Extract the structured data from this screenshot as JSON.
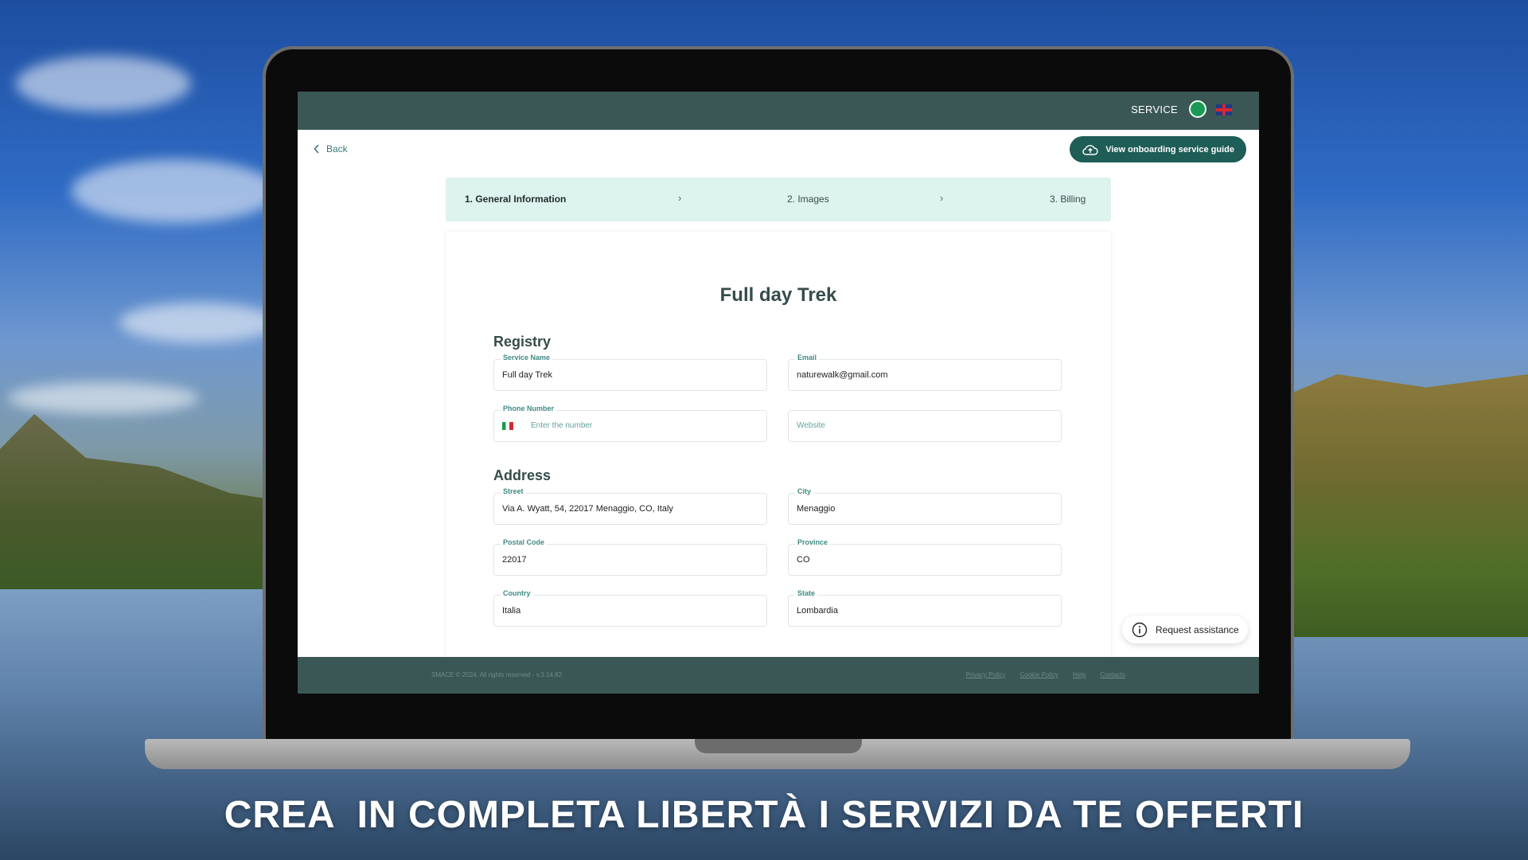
{
  "topbar": {
    "service_label": "SERVICE"
  },
  "back_label": "Back",
  "guide_button": "View onboarding service guide",
  "steps": [
    {
      "label": "1. General Information"
    },
    {
      "label": "2. Images"
    },
    {
      "label": "3. Billing"
    }
  ],
  "step_separator": "›",
  "page_title": "Full day Trek",
  "registry": {
    "title": "Registry",
    "service_name": {
      "label": "Service Name",
      "value": "Full day Trek"
    },
    "email": {
      "label": "Email",
      "value": "naturewalk@gmail.com"
    },
    "phone": {
      "label": "Phone Number",
      "placeholder": "Enter the number"
    },
    "website": {
      "placeholder": "Website"
    }
  },
  "address": {
    "title": "Address",
    "street": {
      "label": "Street",
      "value": "Via A. Wyatt, 54, 22017 Menaggio, CO, Italy"
    },
    "city": {
      "label": "City",
      "value": "Menaggio"
    },
    "postal_code": {
      "label": "Postal Code",
      "value": "22017"
    },
    "province": {
      "label": "Province",
      "value": "CO"
    },
    "country": {
      "label": "Country",
      "value": "Italia"
    },
    "state": {
      "label": "State",
      "value": "Lombardia"
    }
  },
  "request_assistance": "Request assistance",
  "footer": {
    "copyright": "SMACE © 2024. All rights reserved - v.3.14.82",
    "links": [
      "Privacy Policy",
      "Cookie Policy",
      "Help",
      "Contacts"
    ]
  },
  "headline": "CREA  IN COMPLETA LIBERTÀ I SERVIZI DA TE OFFERTI",
  "colors": {
    "brand_dark": "#3a5755",
    "accent": "#1f5d57",
    "stepper_bg": "#ddf3ee"
  },
  "icons": [
    "chevron-left-icon",
    "cloud-upload-icon",
    "info-icon",
    "uk-flag-icon",
    "italy-flag-icon",
    "service-status-icon"
  ]
}
